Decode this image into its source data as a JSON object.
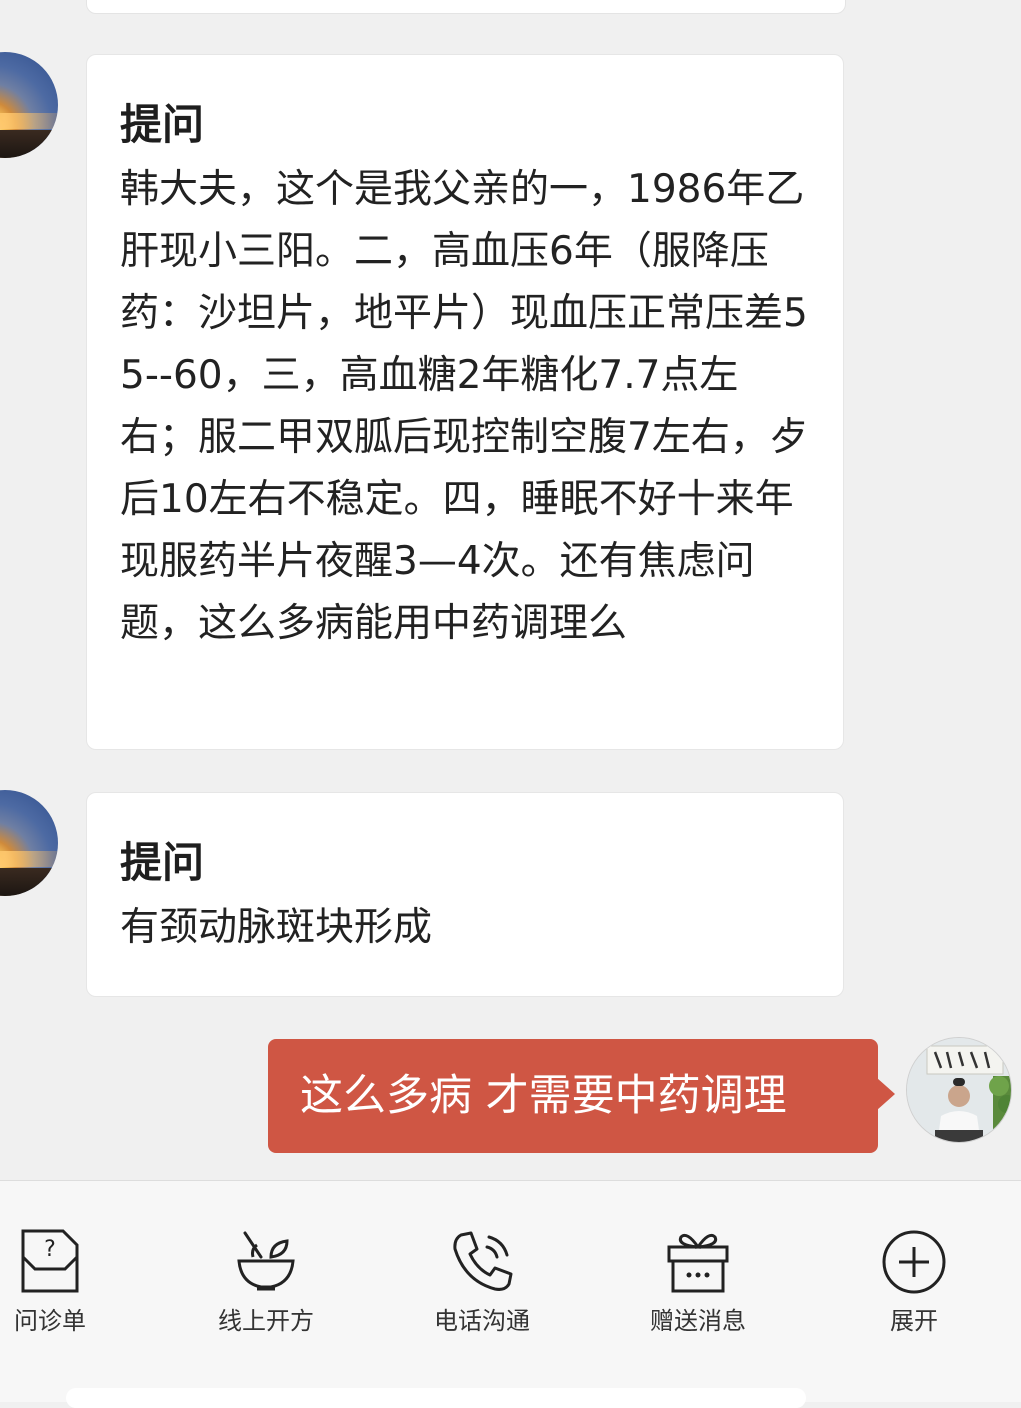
{
  "messages": [
    {
      "title": "提问",
      "body": "韩大夫，这个是我父亲的一，1986年乙肝现小三阳。二，高血压6年（服降压药：沙坦片，地平片）现血压正常压差55--60，三，高血糖2年糖化7.7点左右；服二甲双胍后现控制空腹7左右，歺后10左右不稳定。四，睡眠不好十来年现服药半片夜醒3—4次。还有焦虑问题，这么多病能用中药调理么"
    },
    {
      "title": "提问",
      "body": "有颈动脉斑块形成"
    }
  ],
  "reply": {
    "text": "这么多病 才需要中药调理",
    "bubble_color": "#cf5644"
  },
  "toolbar": {
    "items": [
      {
        "label": "问诊单",
        "icon": "inquiry-form-icon"
      },
      {
        "label": "线上开方",
        "icon": "herbal-bowl-icon"
      },
      {
        "label": "电话沟通",
        "icon": "phone-icon"
      },
      {
        "label": "赠送消息",
        "icon": "gift-icon"
      },
      {
        "label": "展开",
        "icon": "plus-circle-icon"
      }
    ]
  }
}
